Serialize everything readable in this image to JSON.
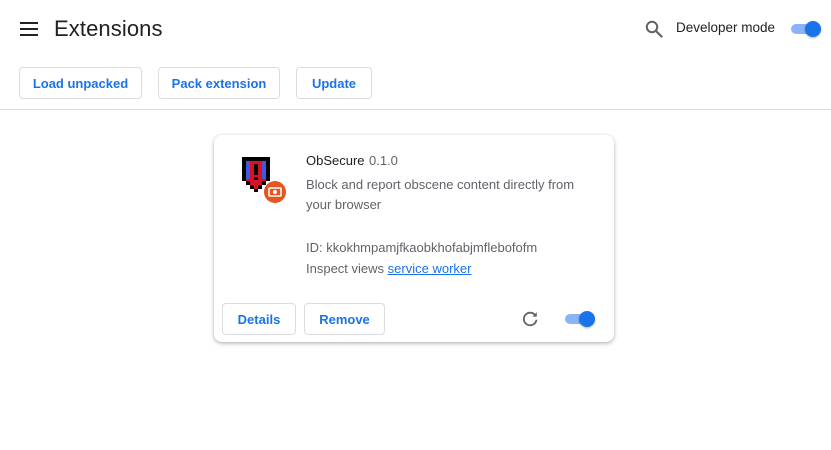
{
  "header": {
    "title": "Extensions",
    "developer_mode_label": "Developer mode",
    "developer_mode_enabled": true,
    "icons": {
      "menu": "hamburger-menu-icon",
      "search": "search-icon"
    }
  },
  "toolbar": {
    "load_unpacked_label": "Load unpacked",
    "pack_extension_label": "Pack extension",
    "update_label": "Update"
  },
  "extension": {
    "name": "ObSecure",
    "version": "0.1.0",
    "description": "Block and report obscene content directly from your browser",
    "id_text": "ID: kkokhmpamjfkaobkhofabjmflebofofm",
    "inspect_label": "Inspect views",
    "inspect_link": "service worker",
    "details_label": "Details",
    "remove_label": "Remove",
    "enabled": true,
    "icons": {
      "extension": "shield-warning-icon",
      "badge": "unpacked-badge-icon",
      "reload": "reload-icon"
    }
  },
  "colors": {
    "accent": "#1a73e8",
    "toggle_track": "#8ab4f8",
    "badge": "#e8541f",
    "shield_red": "#d8112a"
  }
}
